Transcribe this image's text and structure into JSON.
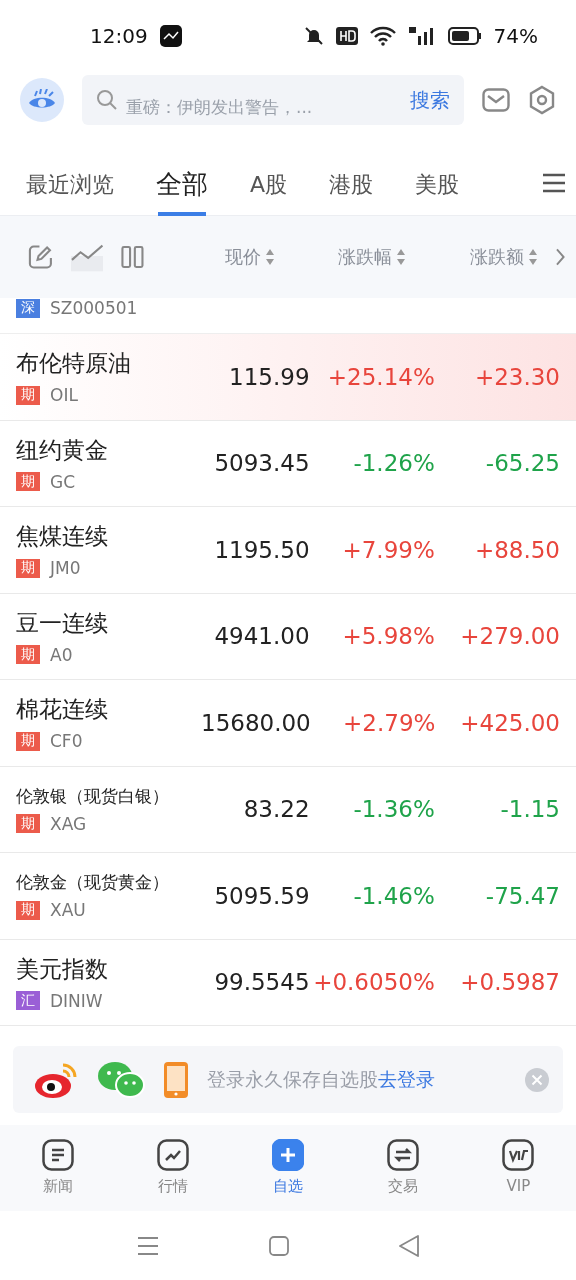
{
  "status_bar": {
    "time": "12:09",
    "battery_text": "74%"
  },
  "header": {
    "search": {
      "placeholder": "重磅：伊朗发出警告，...",
      "button": "搜索"
    }
  },
  "tabs": [
    {
      "label": "最近浏览",
      "selected": false
    },
    {
      "label": "全部",
      "selected": true
    },
    {
      "label": "A股",
      "selected": false
    },
    {
      "label": "港股",
      "selected": false
    },
    {
      "label": "美股",
      "selected": false
    }
  ],
  "columns": [
    "现价",
    "涨跌幅",
    "涨跌额"
  ],
  "partial_row": {
    "tag": {
      "text": "深",
      "color": "#4a7fe0"
    },
    "code": "SZ000501"
  },
  "rows": [
    {
      "name": "布伦特原油",
      "tag": {
        "text": "期",
        "color": "#ec5b4b"
      },
      "code": "OIL",
      "price": "115.99",
      "change_pct": "+25.14%",
      "change": "+23.30",
      "rising": true,
      "selected": true
    },
    {
      "name": "纽约黄金",
      "tag": {
        "text": "期",
        "color": "#ec5b4b"
      },
      "code": "GC",
      "price": "5093.45",
      "change_pct": "-1.26%",
      "change": "-65.25",
      "rising": false,
      "selected": false
    },
    {
      "name": "焦煤连续",
      "tag": {
        "text": "期",
        "color": "#ec5b4b"
      },
      "code": "JM0",
      "price": "1195.50",
      "change_pct": "+7.99%",
      "change": "+88.50",
      "rising": true,
      "selected": false
    },
    {
      "name": "豆一连续",
      "tag": {
        "text": "期",
        "color": "#ec5b4b"
      },
      "code": "A0",
      "price": "4941.00",
      "change_pct": "+5.98%",
      "change": "+279.00",
      "rising": true,
      "selected": false
    },
    {
      "name": "棉花连续",
      "tag": {
        "text": "期",
        "color": "#ec5b4b"
      },
      "code": "CF0",
      "price": "15680.00",
      "change_pct": "+2.79%",
      "change": "+425.00",
      "rising": true,
      "selected": false
    },
    {
      "name": "伦敦银（现货白银）",
      "tag": {
        "text": "期",
        "color": "#ec5b4b"
      },
      "code": "XAG",
      "price": "83.22",
      "change_pct": "-1.36%",
      "change": "-1.15",
      "rising": false,
      "selected": false
    },
    {
      "name": "伦敦金（现货黄金）",
      "tag": {
        "text": "期",
        "color": "#ec5b4b"
      },
      "code": "XAU",
      "price": "5095.59",
      "change_pct": "-1.46%",
      "change": "-75.47",
      "rising": false,
      "selected": false
    },
    {
      "name": "美元指数",
      "tag": {
        "text": "汇",
        "color": "#9a5fd6"
      },
      "code": "DINIW",
      "price": "99.5545",
      "change_pct": "+0.6050%",
      "change": "+0.5987",
      "rising": true,
      "selected": false
    }
  ],
  "login_banner": {
    "text": "登录永久保存自选股",
    "link": "去登录"
  },
  "bottom_nav": [
    {
      "label": "新闻",
      "kind": "news",
      "selected": false
    },
    {
      "label": "行情",
      "kind": "market",
      "selected": false
    },
    {
      "label": "自选",
      "kind": "watch",
      "selected": true
    },
    {
      "label": "交易",
      "kind": "trade",
      "selected": false
    },
    {
      "label": "VIP",
      "kind": "vip",
      "selected": false
    }
  ]
}
